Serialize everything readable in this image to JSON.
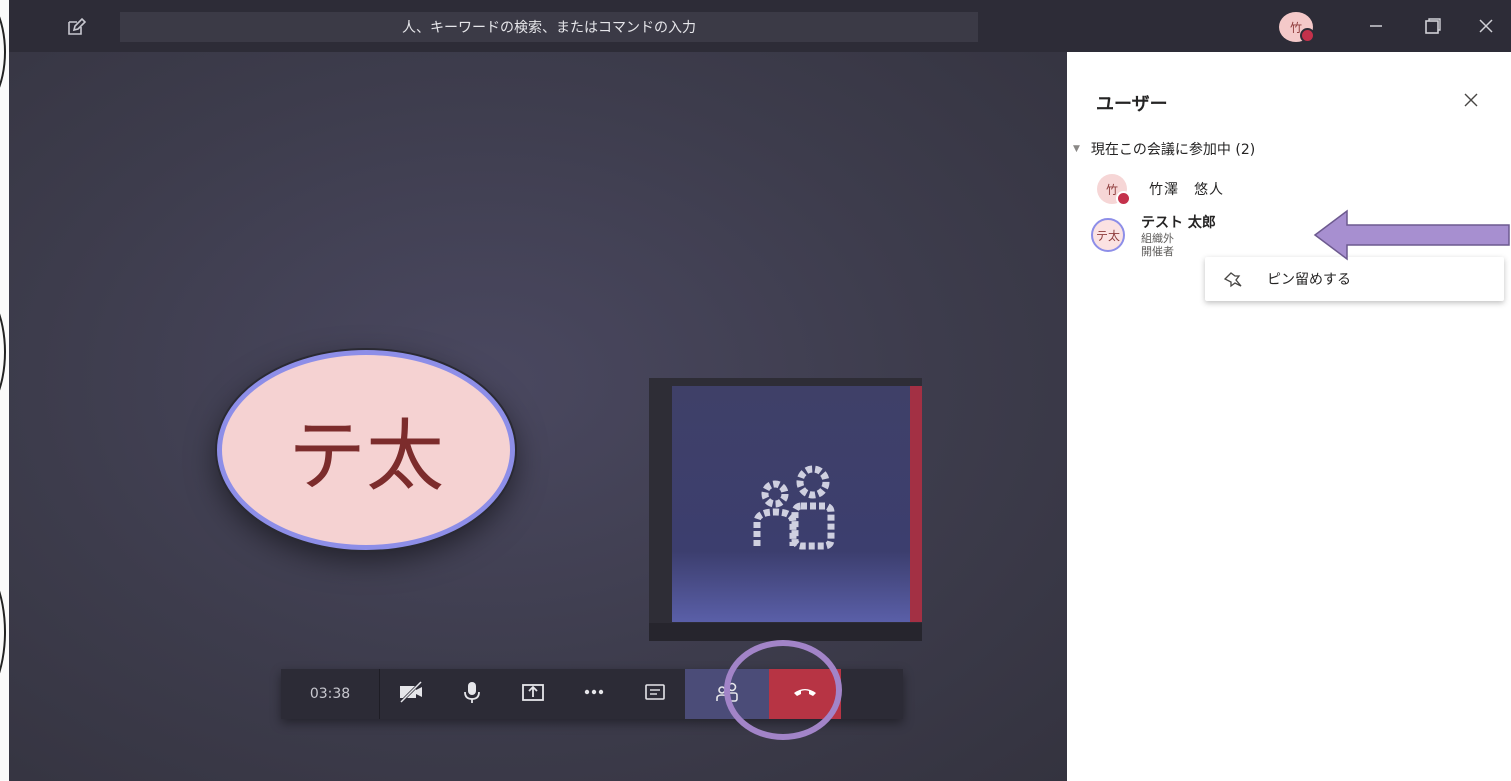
{
  "titlebar": {
    "search_placeholder": "人、キーワードの検索、またはコマンドの入力",
    "user_avatar_initial": "竹"
  },
  "stage": {
    "main_participant_initials": "テ太"
  },
  "controls": {
    "timer": "03:38"
  },
  "panel": {
    "title": "ユーザー",
    "section_label": "現在この会議に参加中 (2)",
    "participants": [
      {
        "initials": "竹",
        "name": "竹澤　悠人"
      },
      {
        "initials": "テ太",
        "name": "テスト 太郎",
        "org": "組織外",
        "role": "開催者"
      }
    ],
    "context_menu": {
      "pin_label": "ピン留めする"
    }
  },
  "colors": {
    "accent": "#8d8ee8",
    "hangup": "#b73444",
    "annotation": "#a284c8"
  }
}
